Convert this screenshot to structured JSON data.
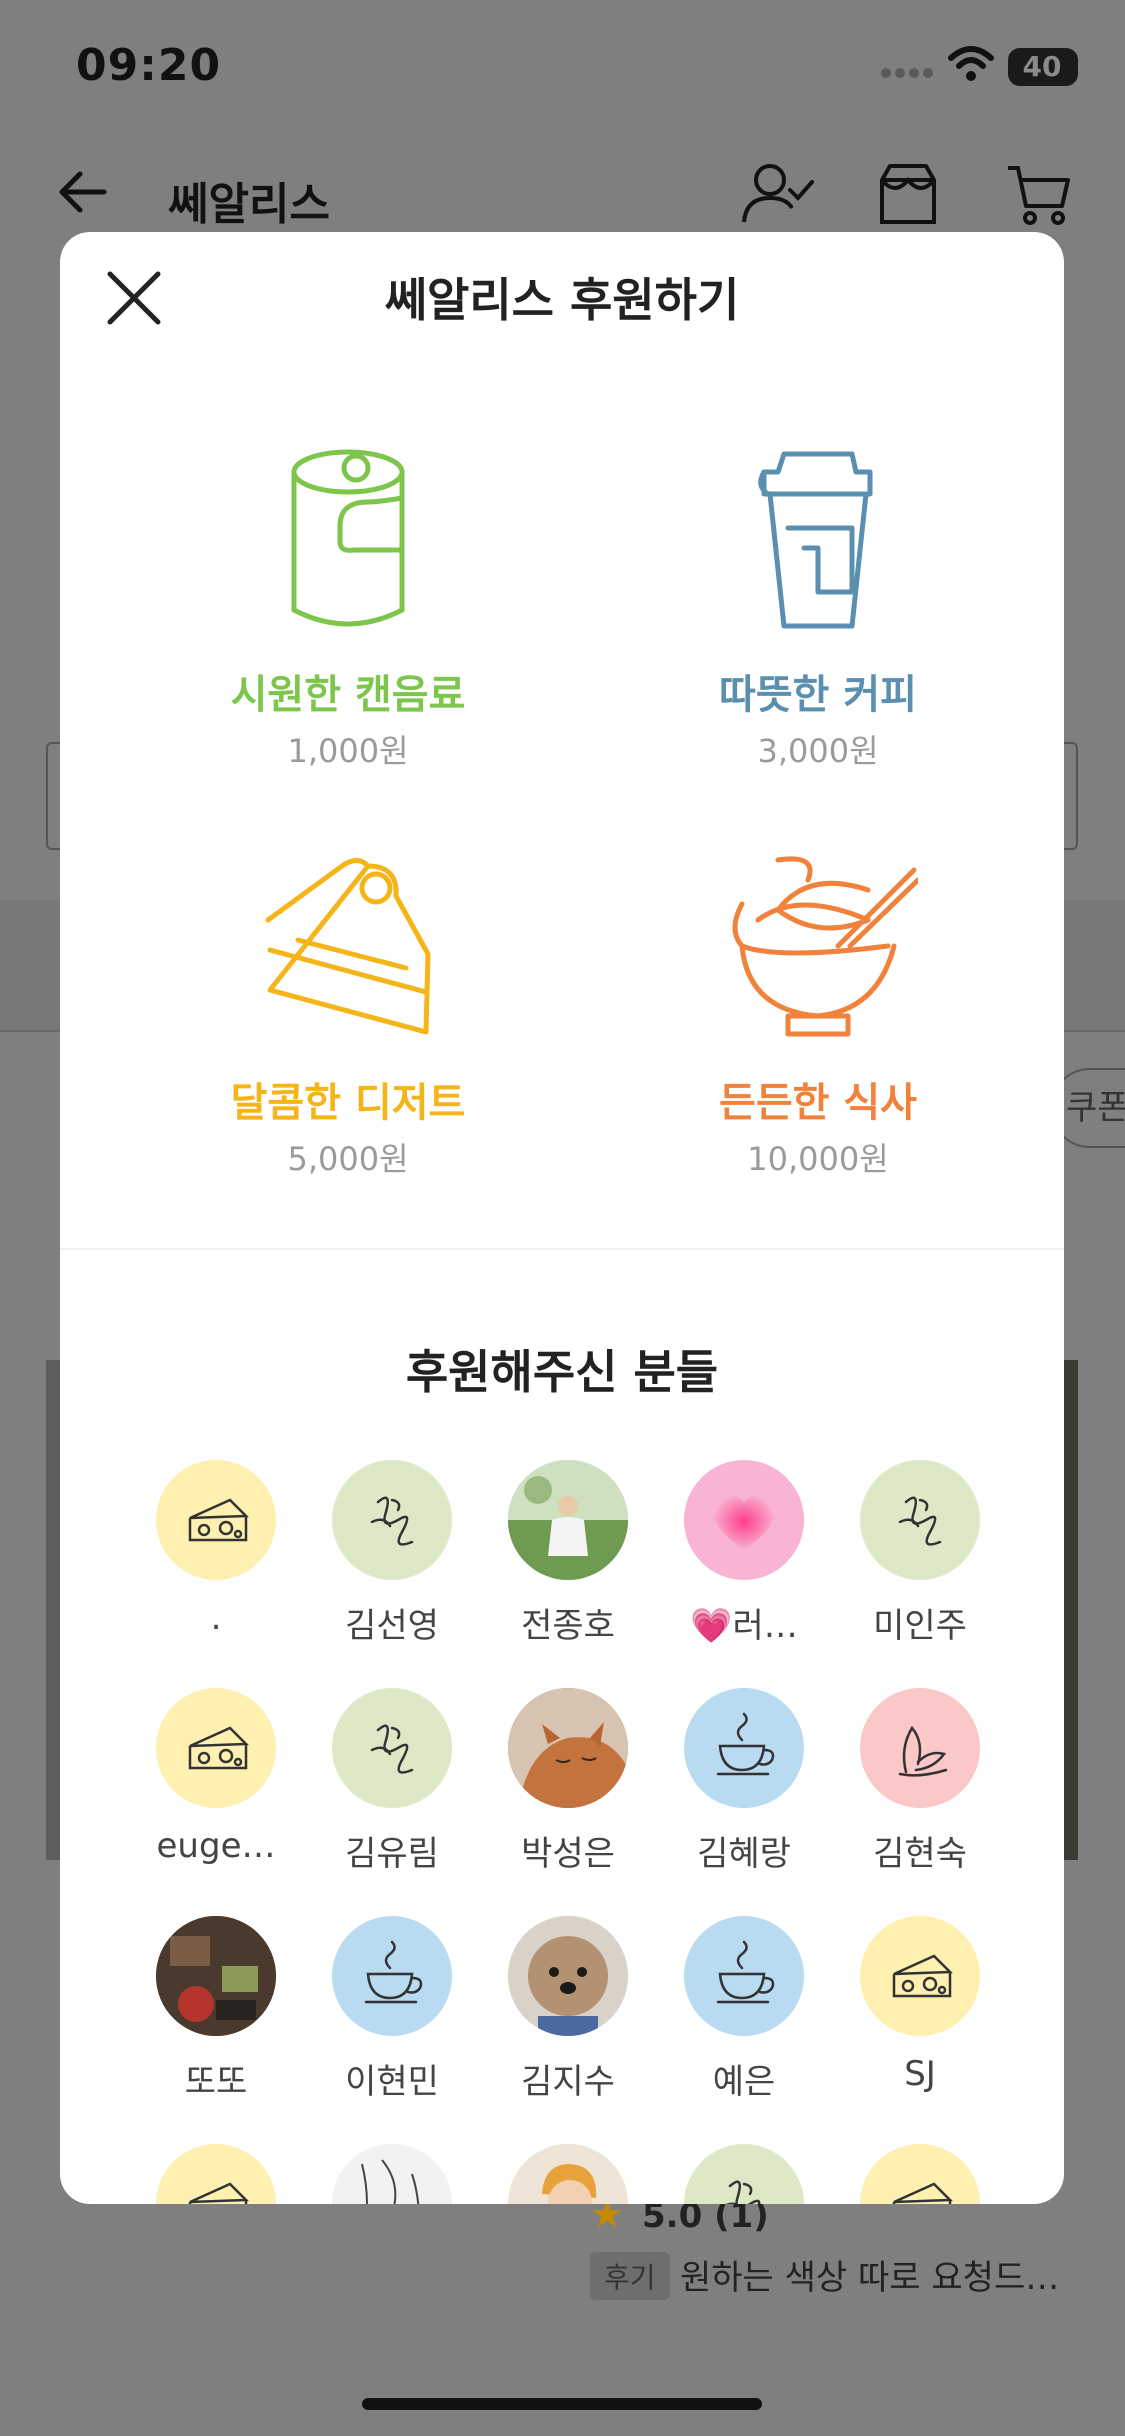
{
  "status_bar": {
    "time": "09:20",
    "battery": "40"
  },
  "background": {
    "store_title": "쎄알리스",
    "coupon_label": "쿠폰",
    "rating": "5.0 (1)",
    "review_tag": "후기",
    "review_text": "원하는 색상 따로 요청드…"
  },
  "modal": {
    "title": "쎄알리스 후원하기",
    "options": [
      {
        "name": "시원한 캔음료",
        "price": "1,000원",
        "color": "#7dc64b",
        "icon": "can-icon"
      },
      {
        "name": "따뜻한 커피",
        "price": "3,000원",
        "color": "#5b8fb0",
        "icon": "coffee-cup-icon"
      },
      {
        "name": "달콤한 디저트",
        "price": "5,000원",
        "color": "#f5b418",
        "icon": "cake-icon"
      },
      {
        "name": "든든한 식사",
        "price": "10,000원",
        "color": "#f0823b",
        "icon": "bowl-icon"
      }
    ],
    "supporters_title": "후원해주신 분들",
    "supporters": [
      {
        "name": ".",
        "avatar": "cheese-icon",
        "bg": "#fdf0b0"
      },
      {
        "name": "김선영",
        "avatar": "flower-sketch-icon",
        "bg": "#dde9c6"
      },
      {
        "name": "전종호",
        "avatar": "photo-child",
        "bg": "#9bb58a"
      },
      {
        "name": "💗러…",
        "avatar": "heart-icon",
        "bg": "#f9b3d3"
      },
      {
        "name": "미인주",
        "avatar": "flower-sketch-icon",
        "bg": "#dde9c6"
      },
      {
        "name": "euge…",
        "avatar": "cheese-icon",
        "bg": "#fdf0b0"
      },
      {
        "name": "김유림",
        "avatar": "flower-sketch-icon",
        "bg": "#dde9c6"
      },
      {
        "name": "박성은",
        "avatar": "photo-cat",
        "bg": "#b0784e"
      },
      {
        "name": "김혜랑",
        "avatar": "teacup-icon",
        "bg": "#b8dbf2"
      },
      {
        "name": "김현숙",
        "avatar": "leaf-icon",
        "bg": "#fbc8c8"
      },
      {
        "name": "또또",
        "avatar": "photo-table",
        "bg": "#5a4a3c"
      },
      {
        "name": "이현민",
        "avatar": "teacup-icon",
        "bg": "#b8dbf2"
      },
      {
        "name": "김지수",
        "avatar": "photo-dog",
        "bg": "#c9b8a6"
      },
      {
        "name": "예은",
        "avatar": "teacup-icon",
        "bg": "#b8dbf2"
      },
      {
        "name": "SJ",
        "avatar": "cheese-icon",
        "bg": "#fdf0b0"
      },
      {
        "name": "",
        "avatar": "cheese-icon",
        "bg": "#fdf0b0"
      },
      {
        "name": "",
        "avatar": "photo-sketch",
        "bg": "#eeeeee"
      },
      {
        "name": "",
        "avatar": "photo-person",
        "bg": "#e8d7c4"
      },
      {
        "name": "",
        "avatar": "flower-sketch-icon",
        "bg": "#dde9c6"
      },
      {
        "name": "",
        "avatar": "cheese-icon",
        "bg": "#fdf0b0"
      }
    ]
  }
}
